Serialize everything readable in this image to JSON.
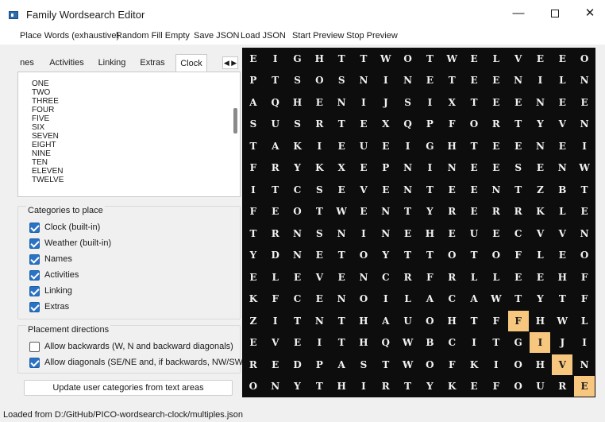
{
  "window": {
    "title": "Family Wordsearch Editor",
    "min_glyph": "—",
    "close_glyph": "✕"
  },
  "menu": [
    "Place Words (exhaustive)",
    "Random Fill Empty",
    "Save JSON",
    "Load JSON",
    "Start Preview",
    "Stop Preview"
  ],
  "tabs": {
    "items": [
      "nes",
      "Activities",
      "Linking",
      "Extras",
      "Clock"
    ],
    "active": "Clock",
    "scroll_glyph": "◀ ▶"
  },
  "clock_words": [
    "ONE",
    "TWO",
    "THREE",
    "FOUR",
    "FIVE",
    "SIX",
    "SEVEN",
    "EIGHT",
    "NINE",
    "TEN",
    "ELEVEN",
    "TWELVE"
  ],
  "categories": {
    "title": "Categories to place",
    "items": [
      {
        "label": "Clock (built-in)",
        "checked": true
      },
      {
        "label": "Weather (built-in)",
        "checked": true
      },
      {
        "label": "Names",
        "checked": true
      },
      {
        "label": "Activities",
        "checked": true
      },
      {
        "label": "Linking",
        "checked": true
      },
      {
        "label": "Extras",
        "checked": true
      }
    ]
  },
  "directions": {
    "title": "Placement directions",
    "items": [
      {
        "label": "Allow backwards (W, N and backward diagonals)",
        "checked": false
      },
      {
        "label": "Allow diagonals (SE/NE and, if backwards, NW/SW)",
        "checked": true
      }
    ]
  },
  "update_button": "Update user categories from text areas",
  "grid": {
    "rows": [
      "EIGHTTWOTWELVEEO",
      "PTSOSNINETEENILN",
      "AQHENIJSIXTEENEE",
      "SUSRTEXQPFORTYVN",
      "TAKIEUEIGHTEENEI",
      "FRYKXEPNINEESENW",
      "ITCSEVENTEENTZBT",
      "FEOTWENTYRERRKLE",
      "TRNSNINEHEUECVVN",
      "YDNETOYTTOTOFLEO",
      "ELEVENCRFRLLEEHF",
      "KFCENOILACAWTYTF",
      "ZITNTHAUOHTFFHWL",
      "EVEITHQWBCITGIJI",
      "REDPASTWOFKIOHVN",
      "ONYTHIRTYKEFOURE"
    ],
    "highlighted": [
      [
        12,
        12
      ],
      [
        13,
        13
      ],
      [
        14,
        14
      ],
      [
        15,
        15
      ]
    ],
    "highlight_color": "#f7c780",
    "background_color": "#0d0d0d",
    "text_color": "#f2f2f2"
  },
  "status": "Loaded from D:/GitHub/PICO-wordsearch-clock/multiples.json",
  "colors": {
    "checkbox": "#2a72c4"
  }
}
